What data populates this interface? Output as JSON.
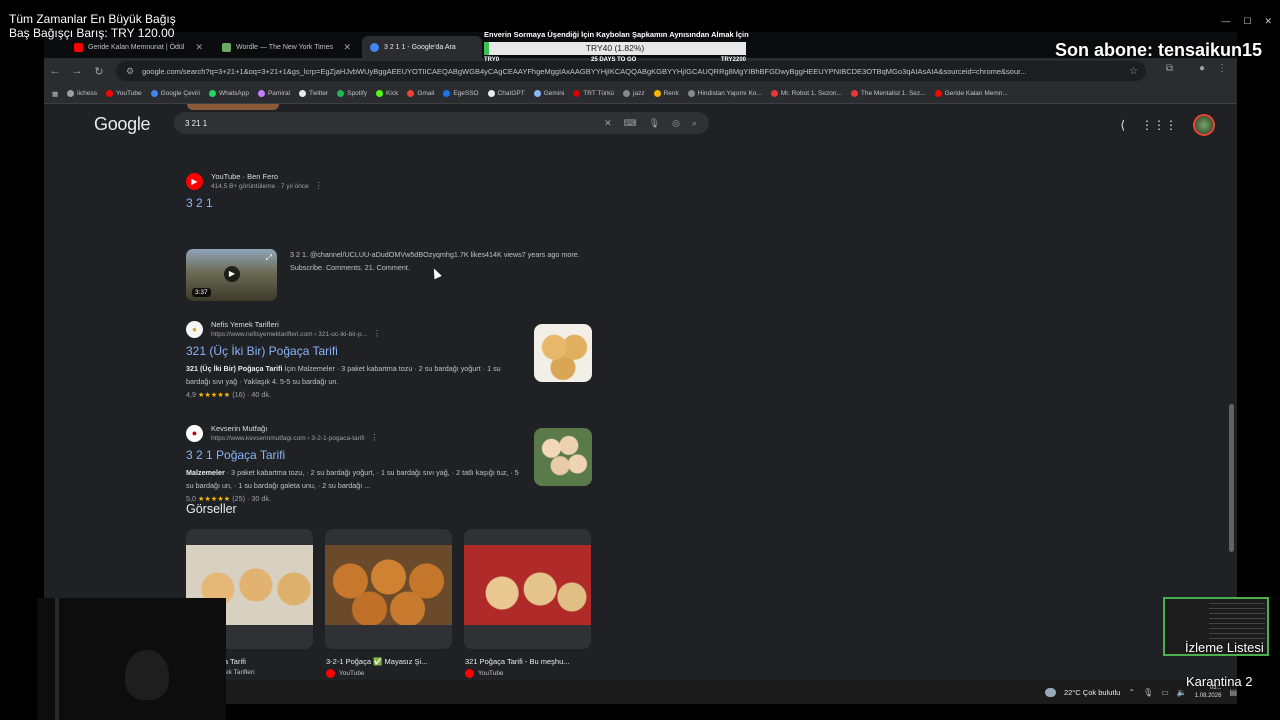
{
  "overlay": {
    "donation_line1": "Tüm Zamanlar En Büyük Bağış",
    "donation_line2": "Baş Bağışçı Barış: TRY 120.00",
    "goal_title": "Enverin Sormaya Üşendiği İçin Kaybolan Şapkamın Aynısından Almak İçin",
    "goal_value": "TRY40 (1.82%)",
    "goal_progress": 0.0182,
    "goal_min": "TRY0",
    "goal_days": "25 DAYS TO GO",
    "goal_max": "TRY2200",
    "last_sub": "Son abone: tensaikun15",
    "watch_list": "İzleme Listesi",
    "scene_label": "Karantina 2"
  },
  "browser": {
    "tabs": [
      {
        "label": "Geride Kalan Memnunat | Ödül",
        "color": "#ff0000"
      },
      {
        "label": "Wordle — The New York Times",
        "color": "#6aaa64"
      },
      {
        "label": "3 2 1 1 - Google'da Ara",
        "color": "#4285f4"
      }
    ],
    "url": "google.com/search?q=3+21+1&oq=3+21+1&gs_lcrp=EgZjaHJvbWUyBggAEEUYOTIICAEQABgWGB4yCAgCEAAYFhgeMggIAxAAGBYYHjIKCAQQABgKGBYYHjIGCAUQRRg8MgYIBhBFGDwyBggHEEUYPNIBCDE3OTBqMGo3qAIAsAIA&sourceid=chrome&sour...",
    "bookmarks": [
      {
        "label": "lichess",
        "color": "#9aa0a6"
      },
      {
        "label": "YouTube",
        "color": "#ff0000"
      },
      {
        "label": "Google Çeviri",
        "color": "#4285f4"
      },
      {
        "label": "WhatsApp",
        "color": "#25d366"
      },
      {
        "label": "Pamiral",
        "color": "#c77dff"
      },
      {
        "label": "Twitter",
        "color": "#e8eaed"
      },
      {
        "label": "Spotify",
        "color": "#1db954"
      },
      {
        "label": "Kick",
        "color": "#53fc18"
      },
      {
        "label": "Gmail",
        "color": "#ea4335"
      },
      {
        "label": "EgeSSO",
        "color": "#1a73e8"
      },
      {
        "label": "ChatGPT",
        "color": "#e8eaed"
      },
      {
        "label": "Gemini",
        "color": "#8ab4f8"
      },
      {
        "label": "TRT Türkü",
        "color": "#d50000"
      },
      {
        "label": "jazz",
        "color": "#888"
      },
      {
        "label": "Renk",
        "color": "#f4b400"
      },
      {
        "label": "Hindistan Yapımı Ko...",
        "color": "#888"
      },
      {
        "label": "Mr. Robot 1. Sezon...",
        "color": "#e53935"
      },
      {
        "label": "The Mentalist 1. Sez...",
        "color": "#e53935"
      },
      {
        "label": "Geride Kalan Memn...",
        "color": "#ff0000"
      }
    ]
  },
  "google": {
    "logo": "Google",
    "query": "3 21 1",
    "results": [
      {
        "site": "YouTube · Ben Fero",
        "url": "414,5 B+ görüntüleme · 7 yıl önce",
        "title": "3 2 1",
        "snippet": "3 2 1. @channel/UCLUU-aDudOMVw5dBOzyqmhg1.7K likes414K views7 years ago more. Subscribe. Comments. 21. Comment.",
        "video_duration": "3:37"
      },
      {
        "site": "Nefis Yemek Tarifleri",
        "url": "https://www.nefisyemektarifleri.com › 321-uc-iki-bir-p...",
        "title": "321 (Üç İki Bir) Poğaça Tarifi",
        "snippet_bold": "321 (Üç İki Bir) Poğaça Tarifi",
        "snippet": " İçin Malzemeler · 3 paket kabartma tozu · 2 su bardağı yoğurt · 1 su bardağı sıvı yağ · Yaklaşık 4. 5-5 su bardağı un.",
        "rating": "4,9",
        "rating_count": "(16) · 40 dk.",
        "stars": "★★★★★"
      },
      {
        "site": "Kevserin Mutfağı",
        "url": "https://www.kevserinmutfagi.com › 3-2-1-pogaca-tarifi",
        "title": "3 2 1 Poğaça Tarifi",
        "snippet_bold": "Malzemeler",
        "snippet": " · 3 paket kabartma tozu, · 2 su bardağı yoğurt, · 1 su bardağı sıvı yağ, · 2 tatlı kaşığı tuz, · 5 su bardağı un, · 1 su bardağı galeta unu, · 2 su bardağı ...",
        "rating": "5,0",
        "rating_count": "(25) · 30 dk.",
        "stars": "★★★★★"
      }
    ],
    "images_heading": "Görseller",
    "images": [
      {
        "caption": "aça Tarifi",
        "source": "emek Tarifleri"
      },
      {
        "caption": "3-2-1 Poğaça ✅ Mayasız Şi...",
        "source": "YouTube"
      },
      {
        "caption": "321 Poğaça Tarifi - Bu meşhu...",
        "source": "YouTube"
      }
    ]
  },
  "taskbar": {
    "weather": "22°C  Çok bulutlu",
    "time": "03:..",
    "date": "1.08.2026"
  }
}
